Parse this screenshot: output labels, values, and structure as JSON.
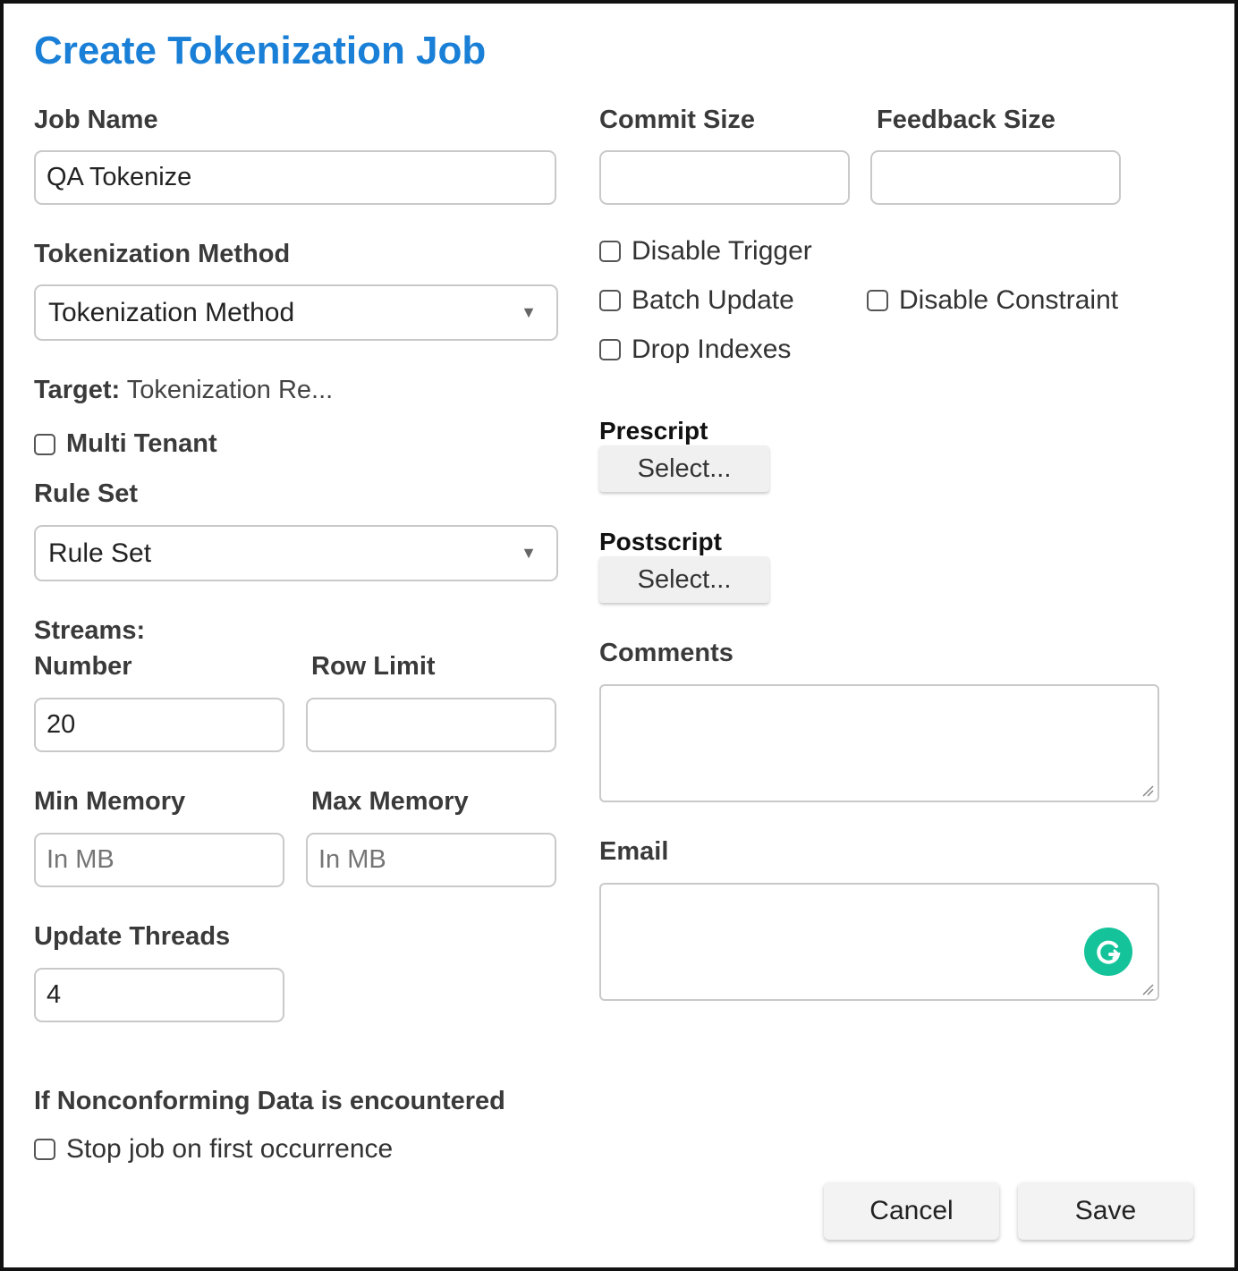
{
  "dialog": {
    "title": "Create Tokenization Job"
  },
  "job_name": {
    "label": "Job Name",
    "value": "QA Tokenize"
  },
  "tokenization_method": {
    "label": "Tokenization Method",
    "selected": "Tokenization Method"
  },
  "target": {
    "label": "Target:",
    "value": "Tokenization Re..."
  },
  "multi_tenant": {
    "label": "Multi Tenant",
    "checked": false
  },
  "rule_set": {
    "label": "Rule Set",
    "selected": "Rule Set"
  },
  "streams": {
    "label": "Streams:"
  },
  "number": {
    "label": "Number",
    "value": "20"
  },
  "row_limit": {
    "label": "Row Limit",
    "value": ""
  },
  "min_memory": {
    "label": "Min Memory",
    "placeholder": "In MB"
  },
  "max_memory": {
    "label": "Max Memory",
    "placeholder": "In MB"
  },
  "update_threads": {
    "label": "Update Threads",
    "value": "4"
  },
  "nonconforming": {
    "heading": "If Nonconforming Data is encountered",
    "stop_label": "Stop job on first occurrence",
    "stop_checked": false
  },
  "commit_size": {
    "label": "Commit Size",
    "value": ""
  },
  "feedback_size": {
    "label": "Feedback Size",
    "value": ""
  },
  "options": {
    "disable_trigger": "Disable Trigger",
    "batch_update": "Batch Update",
    "disable_constraint": "Disable Constraint",
    "drop_indexes": "Drop Indexes"
  },
  "prescript": {
    "label": "Prescript",
    "button": "Select..."
  },
  "postscript": {
    "label": "Postscript",
    "button": "Select..."
  },
  "comments": {
    "label": "Comments",
    "value": ""
  },
  "email": {
    "label": "Email",
    "value": ""
  },
  "actions": {
    "cancel": "Cancel",
    "save": "Save"
  },
  "colors": {
    "title": "#1a7fd6",
    "grammarly": "#15c39a"
  },
  "icons": {
    "dropdown": "caret-down-icon",
    "resize": "resize-grip-icon",
    "assistant": "grammarly-icon"
  }
}
